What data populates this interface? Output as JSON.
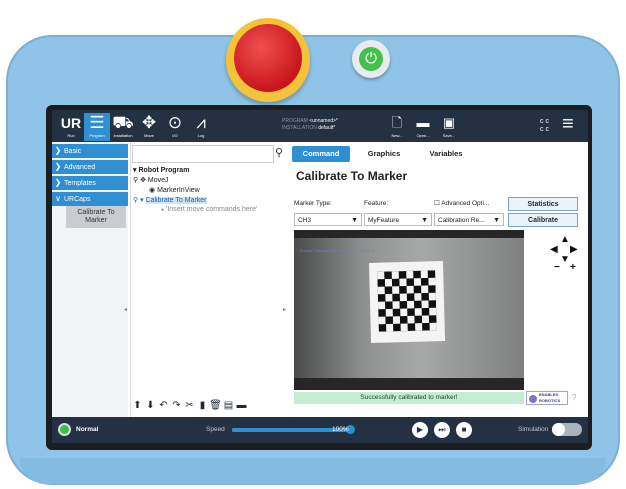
{
  "topbar": {
    "icons": [
      {
        "label": "Run",
        "icon": "ur-logo-icon",
        "glyph": "UR"
      },
      {
        "label": "Program",
        "icon": "program-icon",
        "glyph": "☰"
      },
      {
        "label": "Installation",
        "icon": "installation-icon",
        "glyph": "⛟"
      },
      {
        "label": "Move",
        "icon": "move-icon",
        "glyph": "✥"
      },
      {
        "label": "I/O",
        "icon": "io-icon",
        "glyph": "⊙"
      },
      {
        "label": "Log",
        "icon": "log-icon",
        "glyph": "⩘"
      }
    ],
    "program_key": "PROGRAM",
    "program_value": "<unnamed>*",
    "installation_key": "INSTALLATION",
    "installation_value": "default*",
    "file_buttons": [
      {
        "label": "New...",
        "icon": "new-file-icon",
        "glyph": "🗋"
      },
      {
        "label": "Open...",
        "icon": "open-folder-icon",
        "glyph": "▬"
      },
      {
        "label": "Save...",
        "icon": "save-icon",
        "glyph": "▣"
      }
    ],
    "cc_label": "c c\nc c",
    "menu_glyph": "≡"
  },
  "sidebar": {
    "items": [
      {
        "label": "Basic",
        "chevron": "❯"
      },
      {
        "label": "Advanced",
        "chevron": "❯"
      },
      {
        "label": "Templates",
        "chevron": "❯"
      },
      {
        "label": "URCaps",
        "chevron": "∨"
      }
    ],
    "sub_item": "Calibrate To Marker"
  },
  "tree": {
    "nodes": [
      {
        "label": "Robot Program",
        "prefix": "▾"
      },
      {
        "label": "MoveJ",
        "prefix": "⚲ ✥"
      },
      {
        "label": "MarkerInView",
        "prefix": "◉"
      },
      {
        "label": "Calibrate To Marker",
        "prefix": "⚲ ▾"
      },
      {
        "label": "'Insert move commands here'",
        "prefix": "●"
      }
    ],
    "toolbar": [
      "⬆",
      "⬇",
      "↶",
      "↷",
      "✂",
      "▮",
      "🗑",
      "▤",
      "▬"
    ]
  },
  "panel": {
    "tabs": [
      "Command",
      "Graphics",
      "Variables"
    ],
    "title": "Calibrate To Marker",
    "marker_type_label": "Marker Type:",
    "feature_label": "Feature:",
    "advanced_label": "Advanced Opti...",
    "marker_type_value": "CH3",
    "feature_value": "MyFeature",
    "calibration_value": "Calibration Re...",
    "statistics_button": "Statistics",
    "calibrate_button": "Calibrate",
    "camera_status": "Marker Transformation Found - 1.20/12.86",
    "status_message": "Successfully calibrated to marker!",
    "logo_text": "ENABLED ROBOTICS",
    "help_glyph": "?"
  },
  "jog": {
    "up": "▲",
    "left": "◀",
    "right": "▶",
    "down": "▼",
    "minus": "−",
    "plus": "+"
  },
  "footer": {
    "mode": "Normal",
    "speed_label": "Speed",
    "speed_value": "100%",
    "speed_fraction": 1.0,
    "play": "▶",
    "step": "⏭",
    "stop": "■",
    "simulation_label": "Simulation"
  },
  "colors": {
    "accent": "#2f8fd0",
    "shell": "#8fc4e8",
    "estop": "#d1191f",
    "estop_ring": "#f3c33a",
    "power": "#43c14a",
    "topbar": "#243142",
    "success_bar": "#c4ecd2"
  }
}
